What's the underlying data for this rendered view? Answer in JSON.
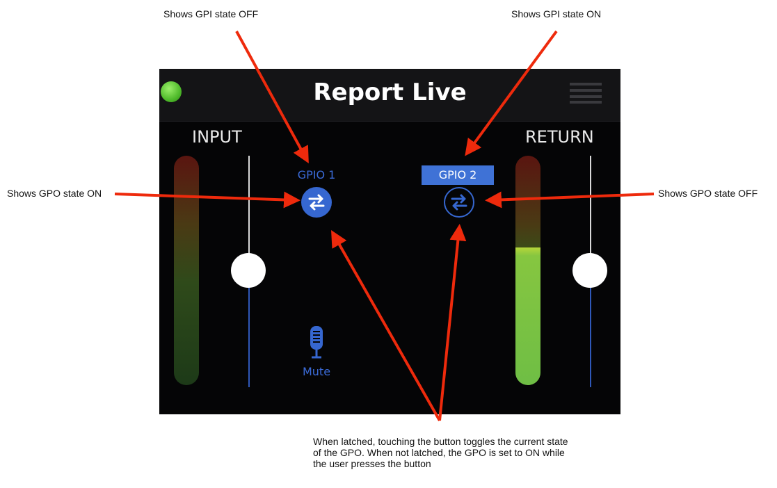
{
  "callouts": {
    "gpi_off": "Shows GPI state OFF",
    "gpi_on": "Shows GPI state ON",
    "gpo_on": "Shows GPO state ON",
    "gpo_off": "Shows GPO state OFF",
    "note": "When latched, touching the button toggles the current state of the GPO. When not latched, the GPO is set to ON while the user presses the button"
  },
  "app": {
    "title": "Report Live",
    "status": "connected",
    "input": {
      "label": "INPUT",
      "meter_level": 0.0,
      "fader_level": 0.53
    },
    "return": {
      "label": "RETURN",
      "meter_level": 0.6,
      "fader_level": 0.53
    },
    "gpio1": {
      "label": "GPIO 1",
      "gpi_state": "OFF",
      "gpo_state": "ON"
    },
    "gpio2": {
      "label": "GPIO 2",
      "gpi_state": "ON",
      "gpo_state": "OFF"
    },
    "mute_label": "Mute"
  },
  "colors": {
    "accent_blue": "#3667d0",
    "status_green": "#4fba2b",
    "arrow_red": "#ee2a0c"
  },
  "icons": {
    "status": "green-dot-icon",
    "menu": "hamburger-menu-icon",
    "gpio": "swap-arrows-icon",
    "mute": "microphone-icon"
  }
}
